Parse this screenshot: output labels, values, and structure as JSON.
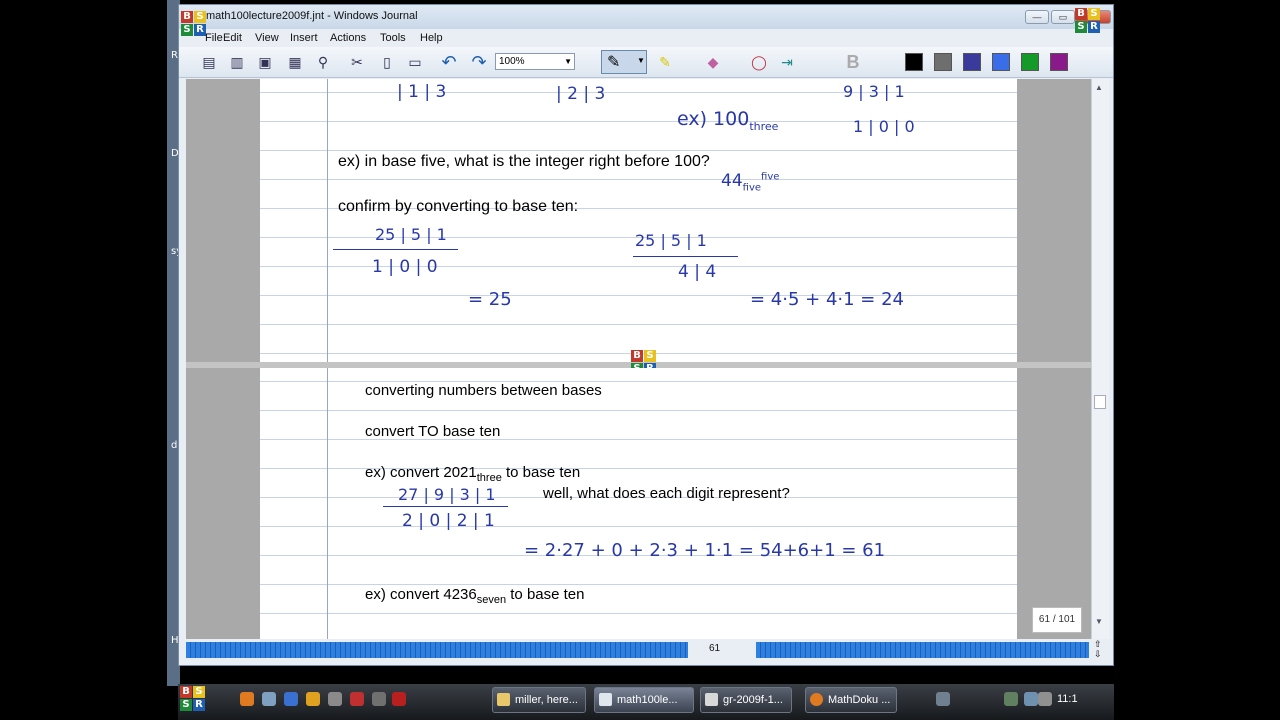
{
  "window": {
    "title": "math100lecture2009f.jnt - Windows Journal",
    "minimize": "—",
    "maximize": "▭",
    "close": "✕"
  },
  "menu": [
    "File",
    "Edit",
    "View",
    "Insert",
    "Actions",
    "Tools",
    "Help"
  ],
  "toolbar": {
    "zoom": "100%",
    "colors": [
      "#000000",
      "#6e6e6e",
      "#3a3a9c",
      "#3a6ee8",
      "#159a2a",
      "#8a1a8a"
    ],
    "buttons": [
      "new-note-icon",
      "open-icon",
      "save-icon",
      "print-icon",
      "find-icon",
      "cut-icon",
      "copy-icon",
      "paste-icon",
      "undo-icon",
      "redo-icon",
      "pen-icon",
      "highlighter-icon",
      "eraser-icon",
      "lasso-icon",
      "insert-space-icon",
      "bold-icon"
    ]
  },
  "page1": {
    "q1": "ex) in base five, what is the integer right before 100?",
    "q2": "confirm by converting to base ten:",
    "ink": {
      "top_left": "| 1 | 3",
      "top_mid": "| 2 | 3",
      "ex_label": "ex) 100",
      "ex_sub": "three",
      "table_head": "9 | 3 | 1",
      "table_row": "1 | 0 | 0",
      "answer": "44",
      "answer_sub": "five",
      "answer_sup": "five",
      "t1_head": "25 | 5 | 1",
      "t1_row": "1 | 0 | 0",
      "t1_result": "= 25",
      "t2_head": "25 | 5 | 1",
      "t2_row": "4 | 4",
      "t2_result": "= 4·5 + 4·1  = 24"
    }
  },
  "page2": {
    "heading": "converting numbers between bases",
    "sub": "convert TO base ten",
    "ex1_prefix": "ex) convert 2021",
    "ex1_sub": "three",
    "ex1_suffix": " to base ten",
    "question": "well, what does each digit represent?",
    "ex2_prefix": "ex) convert 4236",
    "ex2_sub": "seven",
    "ex2_suffix": " to base ten",
    "ink": {
      "head": "27 | 9 | 3 | 1",
      "row": "2 | 0 | 2 | 1",
      "calc": "= 2·27 + 0 + 2·3 + 1·1  = 54+6+1 = 61"
    }
  },
  "pagenav": {
    "current": "61",
    "badge": "61 / 101"
  },
  "taskbar": {
    "buttons": [
      "miller, here...",
      "math100le...",
      "gr-2009f-1...",
      "MathDoku ..."
    ],
    "clock": "11:1"
  },
  "desktop_letters": [
    "R",
    "D",
    "sy",
    "d",
    "H"
  ]
}
